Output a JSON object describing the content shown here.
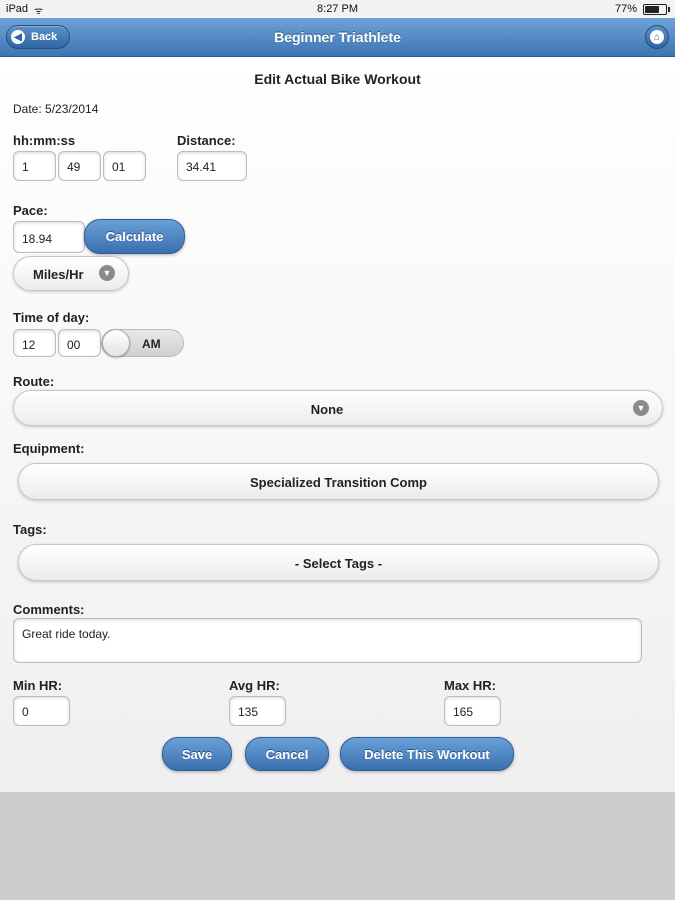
{
  "status": {
    "carrier": "iPad",
    "wifi": "ᯤ",
    "time": "8:27 PM",
    "battery_pct": "77%",
    "battery_level": 0.77
  },
  "header": {
    "title": "Beginner Triathlete",
    "back": "Back"
  },
  "form": {
    "title": "Edit Actual Bike Workout",
    "date": "Date: 5/23/2014",
    "duration_label": "hh:mm:ss",
    "hours": "1",
    "minutes": "49",
    "seconds": "01",
    "distance_label": "Distance:",
    "distance": "34.41",
    "pace_label": "Pace:",
    "pace": "18.94",
    "calculate": "Calculate",
    "pace_unit": "Miles/Hr",
    "time_of_day_label": "Time of day:",
    "tod_hour": "12",
    "tod_min": "00",
    "ampm": "AM",
    "route_label": "Route:",
    "route": "None",
    "equipment_label": "Equipment:",
    "equipment": "Specialized Transition Comp",
    "tags_label": "Tags:",
    "tags": "- Select Tags -",
    "comments_label": "Comments:",
    "comments": "Great ride today.",
    "min_hr_label": "Min HR:",
    "min_hr": "0",
    "avg_hr_label": "Avg HR:",
    "avg_hr": "135",
    "max_hr_label": "Max HR:",
    "max_hr": "165",
    "save": "Save",
    "cancel": "Cancel",
    "delete": "Delete This Workout"
  }
}
